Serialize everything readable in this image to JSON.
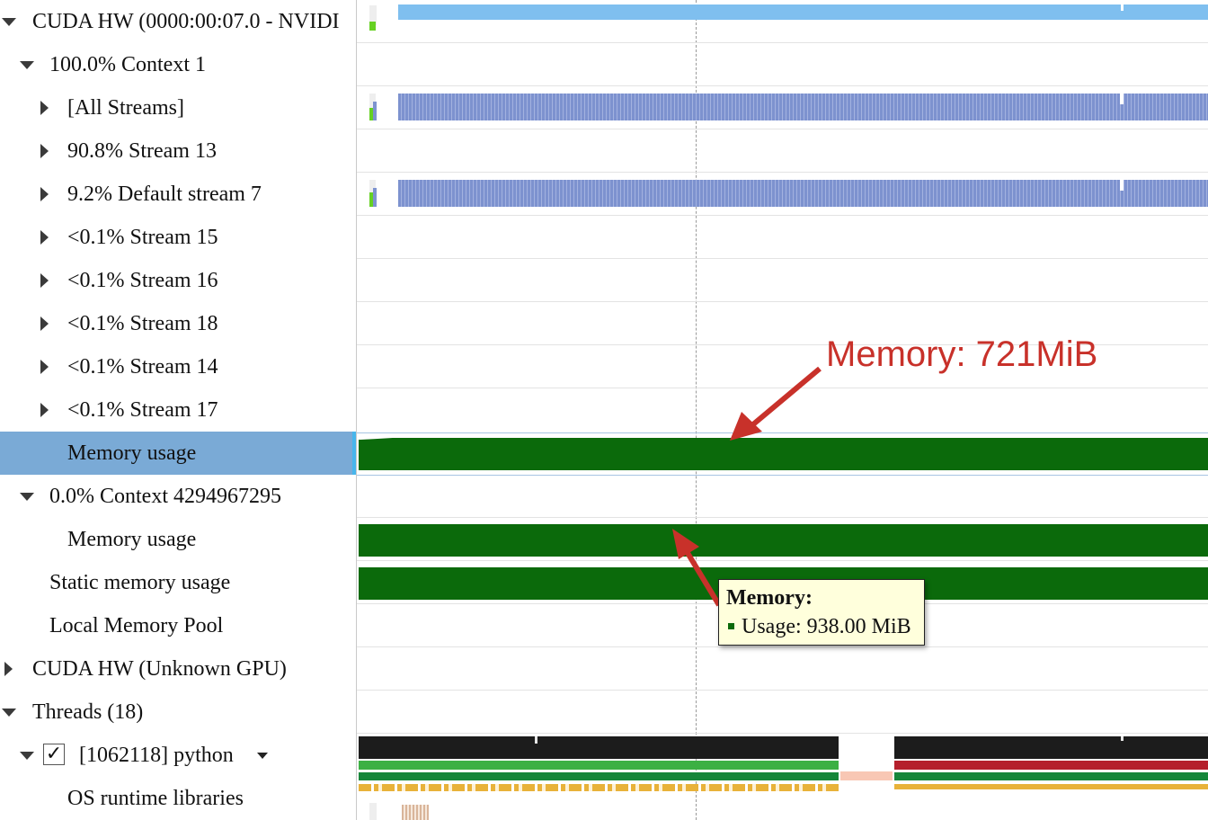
{
  "tree_rows": [
    {
      "label": "CUDA HW (0000:00:07.0 - NVIDI",
      "state": "expanded",
      "indent": 0
    },
    {
      "label": "100.0% Context 1",
      "state": "expanded",
      "indent": 1
    },
    {
      "label": "[All Streams]",
      "state": "collapsed",
      "indent": 2
    },
    {
      "label": "90.8% Stream 13",
      "state": "collapsed",
      "indent": 2
    },
    {
      "label": "9.2% Default stream 7",
      "state": "collapsed",
      "indent": 2
    },
    {
      "label": "<0.1% Stream 15",
      "state": "collapsed",
      "indent": 2
    },
    {
      "label": "<0.1% Stream 16",
      "state": "collapsed",
      "indent": 2
    },
    {
      "label": "<0.1% Stream 18",
      "state": "collapsed",
      "indent": 2
    },
    {
      "label": "<0.1% Stream 14",
      "state": "collapsed",
      "indent": 2
    },
    {
      "label": "<0.1% Stream 17",
      "state": "collapsed",
      "indent": 2
    },
    {
      "label": "Memory usage",
      "state": "leaf",
      "indent": 2,
      "selected": true
    },
    {
      "label": "0.0% Context 4294967295",
      "state": "expanded",
      "indent": 1
    },
    {
      "label": "Memory usage",
      "state": "leaf",
      "indent": 2
    },
    {
      "label": "Static memory usage",
      "state": "leaf",
      "indent": 1
    },
    {
      "label": "Local Memory Pool",
      "state": "leaf",
      "indent": 1
    },
    {
      "label": "CUDA HW (Unknown GPU)",
      "state": "collapsed",
      "indent": 0
    },
    {
      "label": "Threads (18)",
      "state": "expanded",
      "indent": 0
    },
    {
      "label": "[1062118] python",
      "state": "expanded",
      "indent": 1,
      "checkbox": true,
      "checked": true,
      "dropdown": true
    },
    {
      "label": "OS runtime libraries",
      "state": "leaf",
      "indent": 2
    }
  ],
  "tooltip": {
    "title": "Memory:",
    "line": "Usage: 938.00 MiB"
  },
  "annotation": {
    "text": "Memory: 721MiB",
    "color": "#c8312a"
  },
  "colors": {
    "selection": "#7aaad6",
    "memory_bar": "#0b6a0b",
    "stream_bar": "#7d92cf",
    "device_bar": "#7fbfef",
    "thread_bar": "#1c1c1c",
    "os_runtime": "#e8b23a"
  },
  "checkbox_mark": "✓"
}
